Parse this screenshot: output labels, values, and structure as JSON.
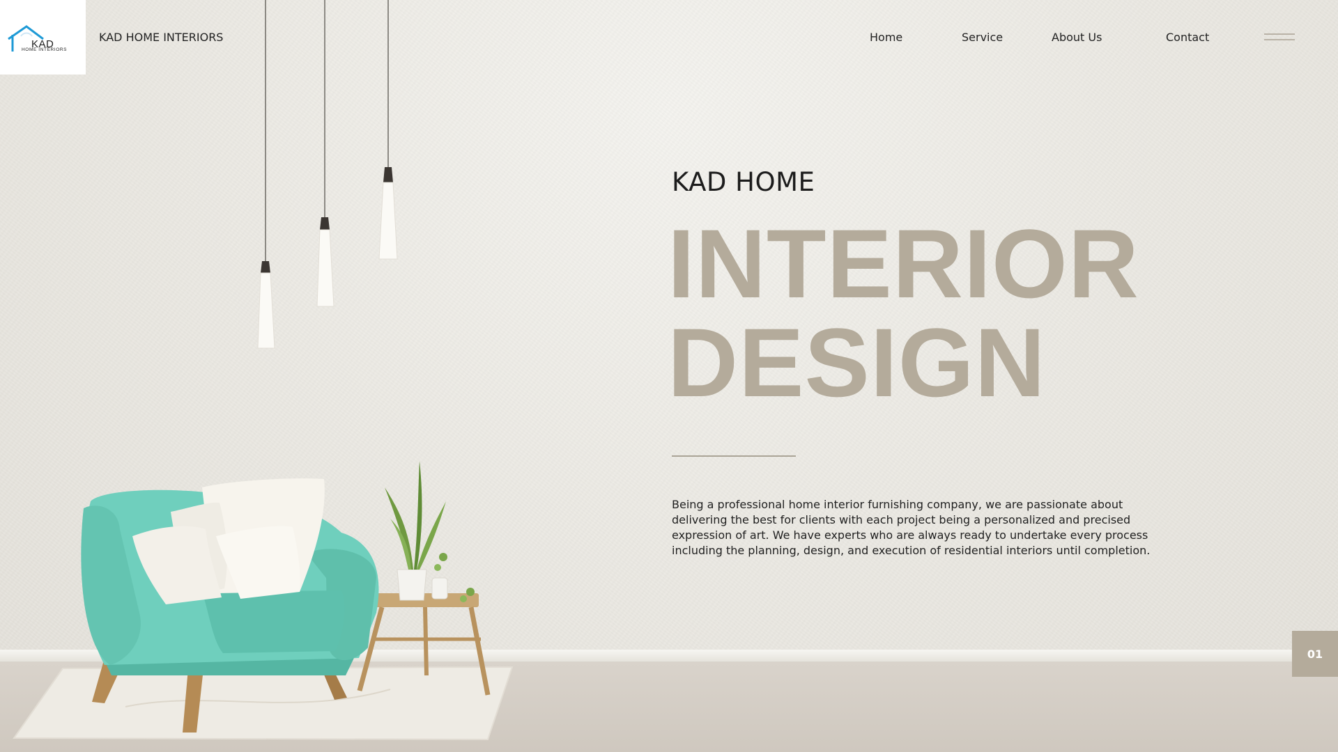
{
  "brand": {
    "logo_text": "KAD",
    "logo_subtext": "HOME INTERIORS",
    "name": "KAD HOME INTERIORS"
  },
  "nav": {
    "items": [
      {
        "label": "Home"
      },
      {
        "label": "Service"
      },
      {
        "label": "About Us"
      },
      {
        "label": "Contact"
      }
    ]
  },
  "hero": {
    "kicker": "KAD HOME",
    "headline_line1": "INTERIOR",
    "headline_line2": "DESIGN",
    "description": "Being a professional home interior furnishing company, we are passionate about delivering the best for clients with each project being a personalized and precised expression of art. We have experts who are always ready to undertake every process including the planning, design, and execution of residential interiors until completion."
  },
  "slide": {
    "number": "01"
  },
  "colors": {
    "accent": "#b4ab9b",
    "logo_blue": "#1e9ad6",
    "armchair": "#6fcfbd",
    "text": "#222222"
  },
  "icons": {
    "menu": "hamburger-icon",
    "logo": "house-roof-icon"
  }
}
